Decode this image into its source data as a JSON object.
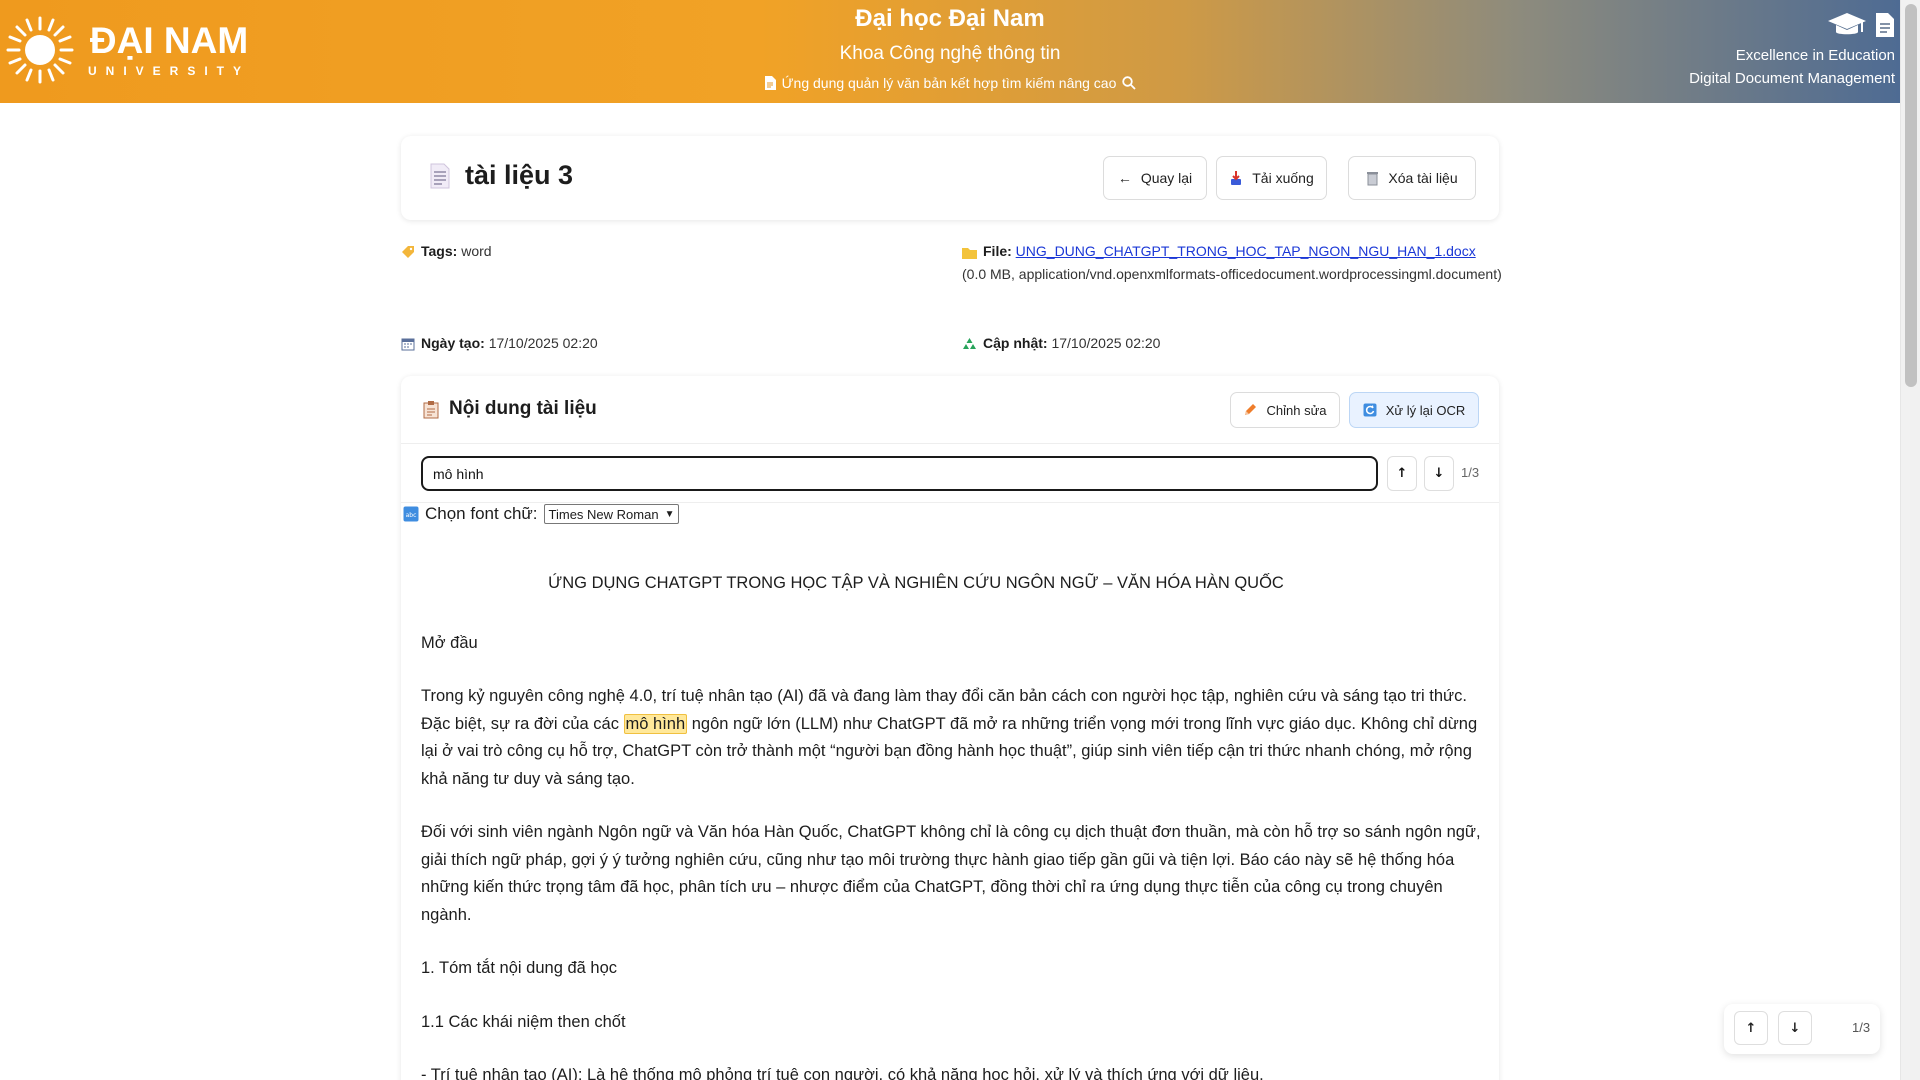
{
  "header": {
    "logo_name": "ĐẠI NAM",
    "logo_sub": "UNIVERSITY",
    "title": "Đại học Đại Nam",
    "subtitle": "Khoa Công nghệ thông tin",
    "tagline": "Ứng dụng quản lý văn bản kết hợp tìm kiếm nâng cao",
    "right_line1": "Excellence in Education",
    "right_line2": "Digital Document Management"
  },
  "document": {
    "title": "tài liệu 3",
    "buttons": {
      "back": "Quay lại",
      "download": "Tải xuống",
      "delete": "Xóa tài liệu"
    }
  },
  "meta": {
    "tags_label": "Tags:",
    "tags_value": "word",
    "file_label": "File:",
    "file_name": "UNG_DUNG_CHATGPT_TRONG_HOC_TAP_NGON_NGU_HAN_1.docx",
    "file_info": "(0.0 MB, application/vnd.openxmlformats-officedocument.wordprocessingml.document)",
    "created_label": "Ngày tạo:",
    "created_value": "17/10/2025 02:20",
    "updated_label": "Cập nhật:",
    "updated_value": "17/10/2025 02:20"
  },
  "content": {
    "title": "Nội dung tài liệu",
    "edit_label": "Chỉnh sửa",
    "ocr_label": "Xử lý lại OCR",
    "search_value": "mô hình",
    "match_counter": "1/3",
    "font_label": "Chọn font chữ:",
    "font_selected": "Times New Roman"
  },
  "body": {
    "heading": "ỨNG DỤNG CHATGPT TRONG HỌC TẬP VÀ NGHIÊN CỨU NGÔN NGỮ – VĂN HÓA HÀN QUỐC",
    "intro_label": "Mở đầu",
    "p1_before": "Trong kỷ nguyên công nghệ 4.0, trí tuệ nhân tạo (AI) đã và đang làm thay đổi căn bản cách con người học tập, nghiên cứu và sáng tạo tri thức. Đặc biệt, sự ra đời của các ",
    "p1_highlight": "mô hình",
    "p1_after": " ngôn ngữ lớn (LLM) như ChatGPT đã mở ra những triển vọng mới trong lĩnh vực giáo dục. Không chỉ dừng lại ở vai trò công cụ hỗ trợ, ChatGPT còn trở thành một “người bạn đồng hành học thuật”, giúp sinh viên tiếp cận tri thức nhanh chóng, mở rộng khả năng tư duy và sáng tạo.",
    "p2": "Đối với sinh viên ngành Ngôn ngữ và Văn hóa Hàn Quốc, ChatGPT không chỉ là công cụ dịch thuật đơn thuần, mà còn hỗ trợ so sánh ngôn ngữ, giải thích ngữ pháp, gợi ý ý tưởng nghiên cứu, cũng như tạo môi trường thực hành giao tiếp gần gũi và tiện lợi. Báo cáo này sẽ hệ thống hóa những kiến thức trọng tâm đã học, phân tích ưu – nhược điểm của ChatGPT, đồng thời chỉ ra ứng dụng thực tiễn của công cụ trong chuyên ngành.",
    "s1": "1. Tóm tắt nội dung đã học",
    "s11": "1.1 Các khái niệm then chốt",
    "bullet1": "- Trí tuệ nhân tạo (AI): Là hệ thống mô phỏng trí tuệ con người, có khả năng học hỏi, xử lý và thích ứng với dữ liệu."
  },
  "float_nav": {
    "counter": "1/3"
  },
  "icons": {
    "logo": "sun-logo-icon",
    "doc": "document-icon",
    "search": "search-icon",
    "cap": "graduation-cap-icon",
    "file": "file-icon"
  }
}
